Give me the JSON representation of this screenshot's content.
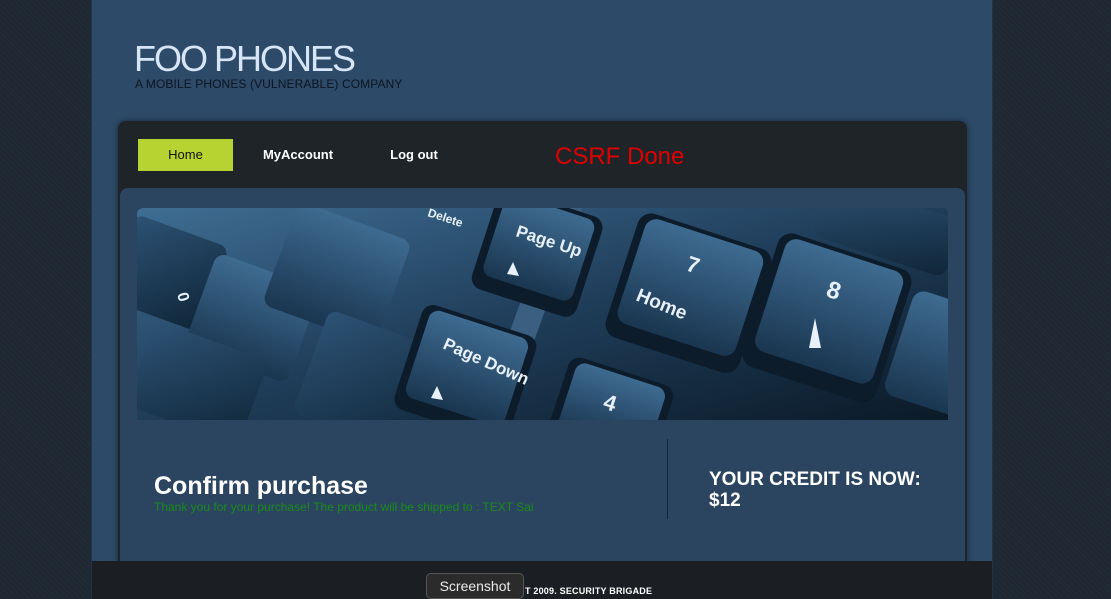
{
  "header": {
    "title": "FOO PHONES",
    "subtitle": "A MOBILE PHONES (VULNERABLE) COMPANY"
  },
  "nav": {
    "items": [
      {
        "label": "Home",
        "active": true
      },
      {
        "label": "MyAccount"
      },
      {
        "label": "Log out"
      }
    ],
    "status": "CSRF Done",
    "status_color": "#e00000",
    "active_color": "#b6d332"
  },
  "banner": {
    "keys": [
      "Page Up",
      "7",
      "8",
      "Home",
      "Page Down",
      "4",
      "0",
      "Delete"
    ]
  },
  "main": {
    "heading": "Confirm purchase",
    "message": "Thank you for your purchase! The product will be shipped to : TEXT Sai",
    "credit": "YOUR CREDIT IS NOW: $12"
  },
  "footer": {
    "text": "T 2009. SECURITY BRIGADE"
  },
  "overlay": {
    "button_label": "Screenshot"
  }
}
